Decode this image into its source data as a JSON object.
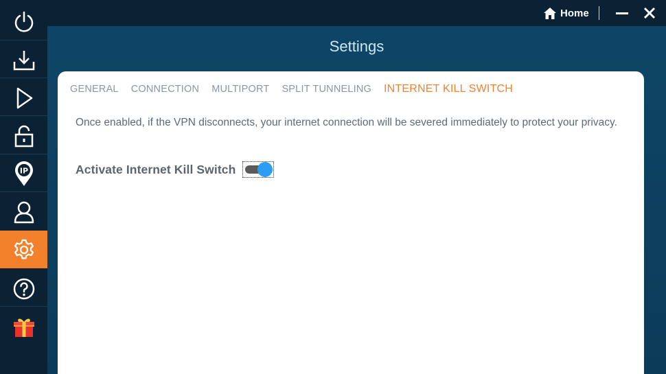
{
  "window": {
    "home_label": "Home"
  },
  "header": {
    "title": "Settings"
  },
  "sidebar": {
    "items": [
      {
        "icon": "power-icon"
      },
      {
        "icon": "download-icon"
      },
      {
        "icon": "play-icon"
      },
      {
        "icon": "lock-icon"
      },
      {
        "icon": "ip-location-icon"
      },
      {
        "icon": "user-icon"
      },
      {
        "icon": "gear-icon",
        "active": true
      },
      {
        "icon": "help-icon"
      },
      {
        "icon": "gift-icon"
      }
    ]
  },
  "tabs": [
    {
      "label": "GENERAL"
    },
    {
      "label": "CONNECTION"
    },
    {
      "label": "MULTIPORT"
    },
    {
      "label": "SPLIT TUNNELING"
    },
    {
      "label": "INTERNET KILL SWITCH",
      "active": true
    }
  ],
  "kill_switch": {
    "description": "Once enabled, if the VPN disconnects, your internet connection will be severed immediately to protect your privacy.",
    "toggle_label": "Activate Internet Kill Switch",
    "enabled": true
  },
  "colors": {
    "accent": "#f3802a",
    "toggle_on": "#2a9df4",
    "sidebar_bg": "#0b2134"
  }
}
